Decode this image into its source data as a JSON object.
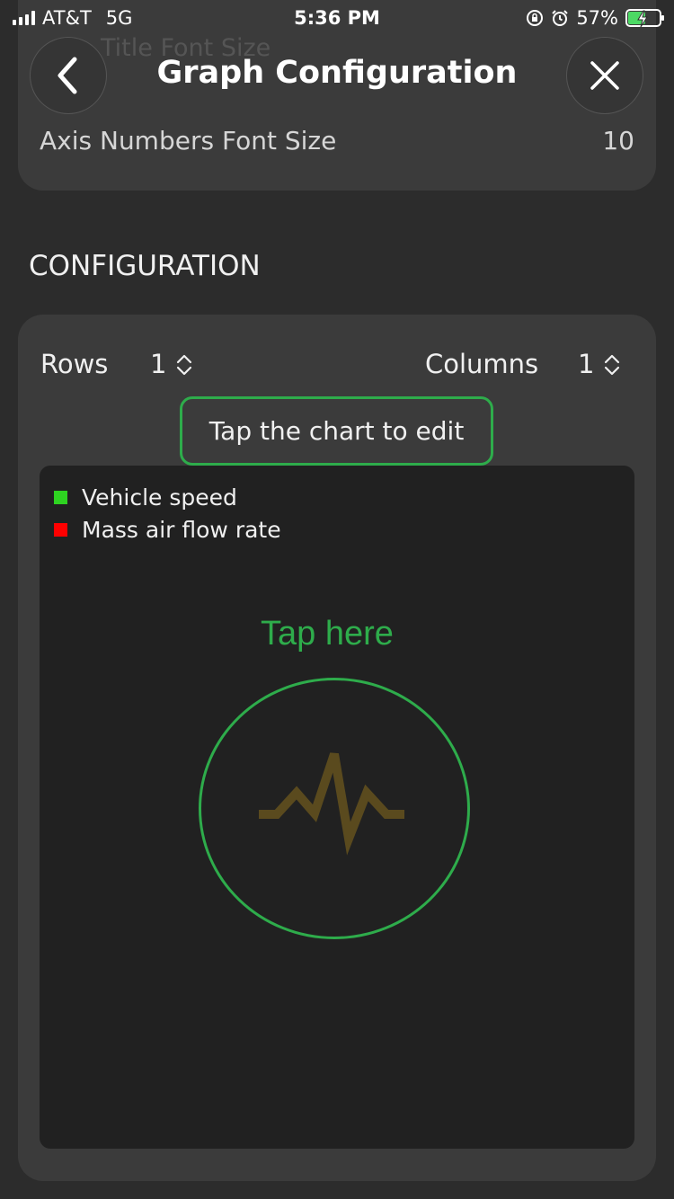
{
  "status_bar": {
    "carrier": "AT&T",
    "network": "5G",
    "time": "5:36 PM",
    "battery": "57%",
    "battery_level": 0.57
  },
  "nav": {
    "title": "Graph Configuration",
    "back_icon": "chevron-left-icon",
    "close_icon": "close-icon"
  },
  "display_settings": {
    "title_font_size_label": "Title Font Size",
    "axis_numbers_font_size_label": "Axis Numbers Font Size",
    "axis_numbers_font_size_value": "10"
  },
  "configuration": {
    "section_title": "CONFIGURATION",
    "rows_label": "Rows",
    "rows_value": "1",
    "columns_label": "Columns",
    "columns_value": "1",
    "hint": "Tap the chart to edit"
  },
  "chart": {
    "legend": [
      {
        "label": "Vehicle speed",
        "color": "#2ed321"
      },
      {
        "label": "Mass air flow rate",
        "color": "#ff0000"
      }
    ],
    "tap_label": "Tap here",
    "placeholder_icon": "pulse-icon",
    "accent": "#2eac4b",
    "icon_color": "#5a4a1e"
  }
}
